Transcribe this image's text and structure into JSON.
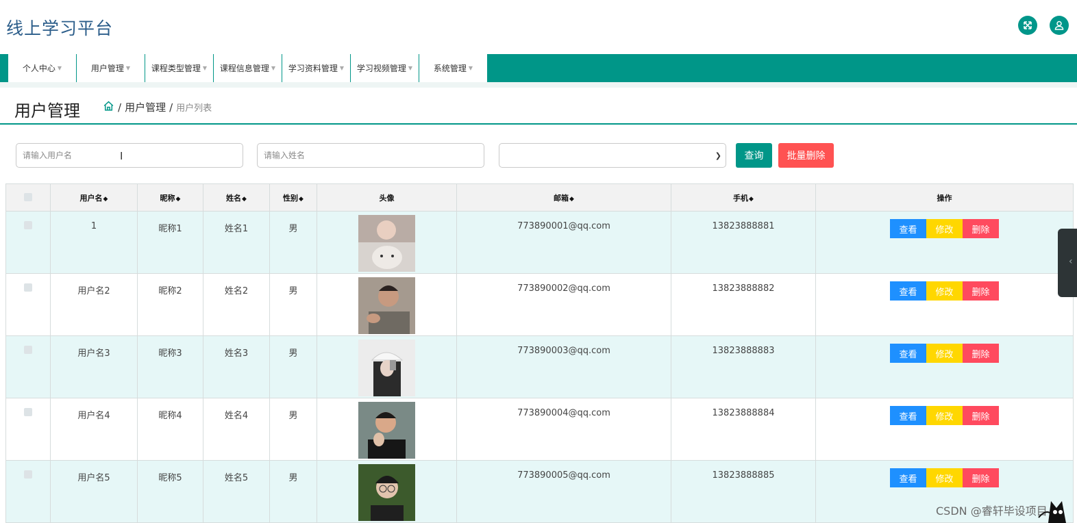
{
  "app": {
    "title": "线上学习平台"
  },
  "header": {
    "icons": [
      "expand-icon",
      "user-icon"
    ],
    "accent": "#009688"
  },
  "nav": {
    "items": [
      "个人中心",
      "用户管理",
      "课程类型管理",
      "课程信息管理",
      "学习资料管理",
      "学习视频管理",
      "系统管理"
    ]
  },
  "page": {
    "title": "用户管理",
    "breadcrumb": {
      "level1": "用户管理",
      "level2": "用户列表",
      "separator": "/"
    }
  },
  "filters": {
    "username_placeholder": "请输入用户名",
    "name_placeholder": "请输入姓名",
    "select_value": "",
    "query_label": "查询",
    "batch_delete_label": "批量删除"
  },
  "table": {
    "headers": {
      "username": "用户名",
      "nickname": "昵称",
      "name": "姓名",
      "gender": "性别",
      "avatar": "头像",
      "email": "邮箱",
      "phone": "手机",
      "actions": "操作"
    },
    "action_labels": {
      "view": "查看",
      "edit": "修改",
      "delete": "删除"
    },
    "rows": [
      {
        "username": "1",
        "nickname": "昵称1",
        "name": "姓名1",
        "gender": "男",
        "email": "773890001@qq.com",
        "phone": "13823888881"
      },
      {
        "username": "用户名2",
        "nickname": "昵称2",
        "name": "姓名2",
        "gender": "男",
        "email": "773890002@qq.com",
        "phone": "13823888882"
      },
      {
        "username": "用户名3",
        "nickname": "昵称3",
        "name": "姓名3",
        "gender": "男",
        "email": "773890003@qq.com",
        "phone": "13823888883"
      },
      {
        "username": "用户名4",
        "nickname": "昵称4",
        "name": "姓名4",
        "gender": "男",
        "email": "773890004@qq.com",
        "phone": "13823888884"
      },
      {
        "username": "用户名5",
        "nickname": "昵称5",
        "name": "姓名5",
        "gender": "男",
        "email": "773890005@qq.com",
        "phone": "13823888885"
      }
    ]
  },
  "watermark": "CSDN @睿轩毕设项目"
}
